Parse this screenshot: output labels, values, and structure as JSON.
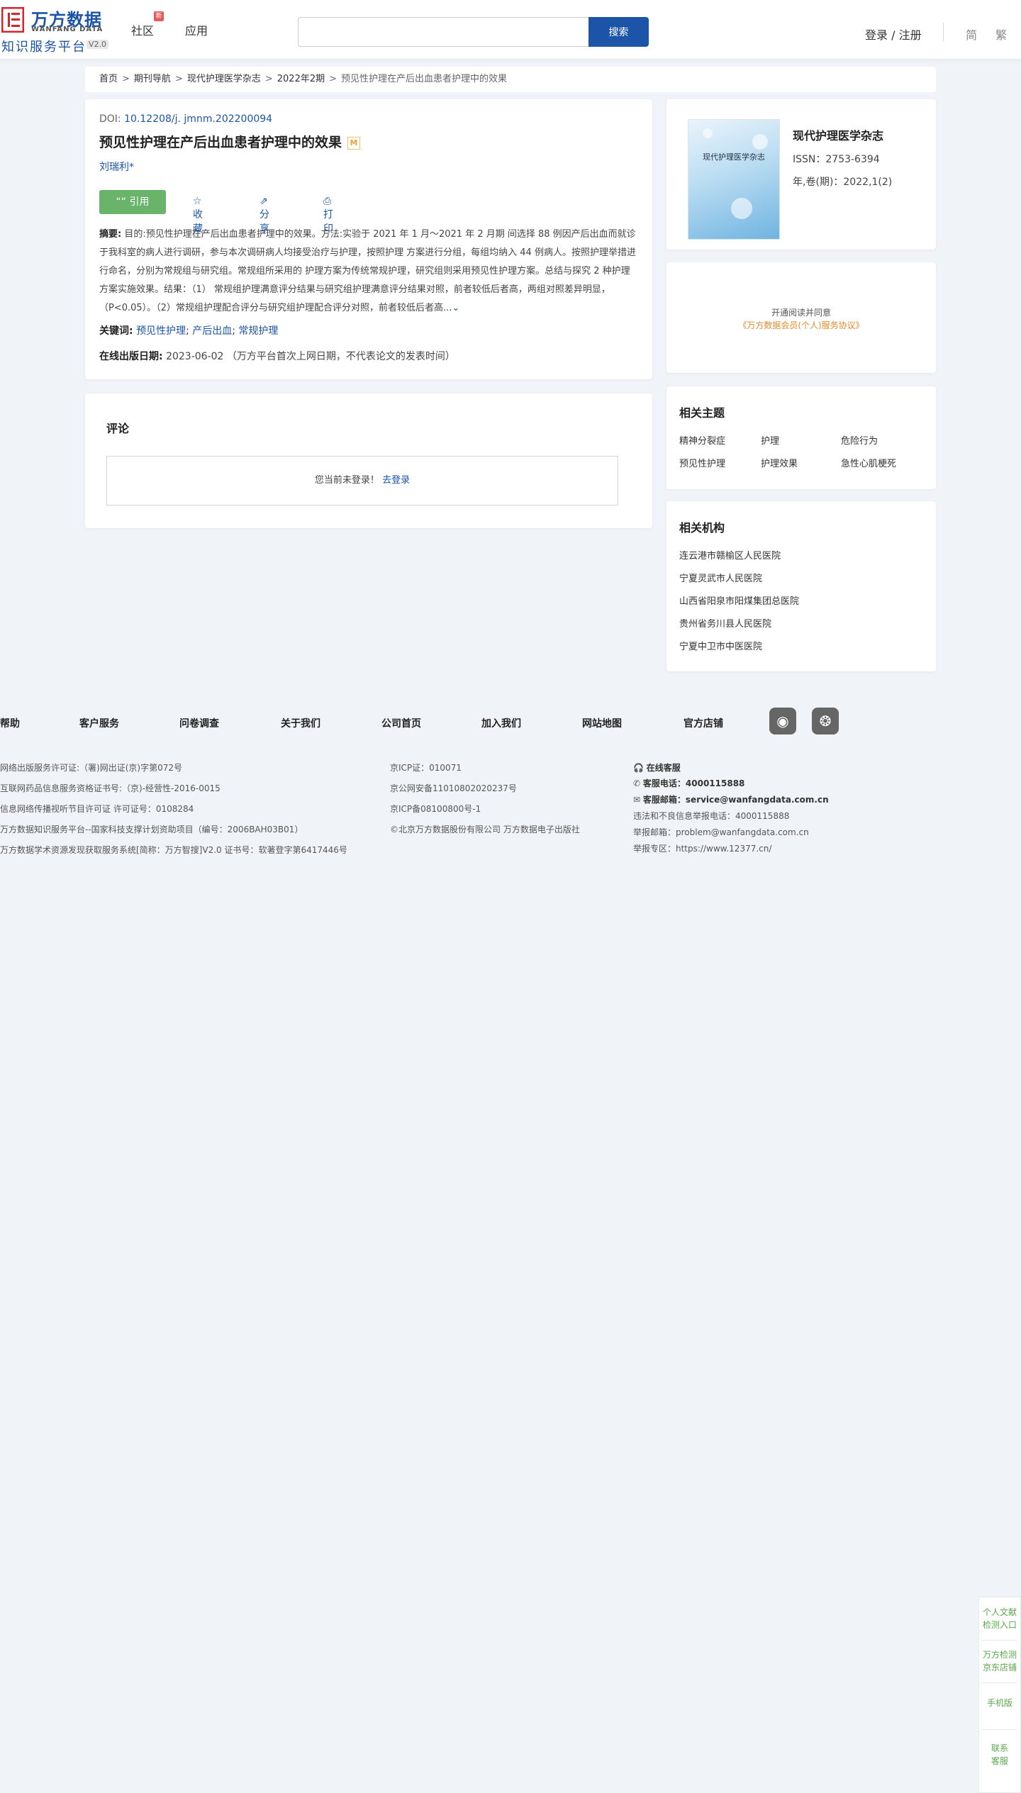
{
  "header": {
    "logo_cn": "万方数据",
    "logo_en": "WANFANG DATA",
    "logo_sub": "知识服务平台",
    "logo_version": "V2.0",
    "nav": [
      "社区",
      "应用"
    ],
    "nav_badge": "新",
    "search_placeholder": "",
    "search_button": "搜索",
    "login": "登录 / 注册",
    "lang_simplified": "简",
    "lang_traditional": "繁"
  },
  "breadcrumb": [
    "首页",
    "期刊导航",
    "现代护理医学杂志",
    "2022年2期",
    "预见性护理在产后出血患者护理中的效果"
  ],
  "article": {
    "doi_label": "DOI:",
    "doi": "10.12208/j. jmnm.202200094",
    "title": "预见性护理在产后出血患者护理中的效果",
    "title_badge": "M",
    "author": "刘瑞利*",
    "actions": {
      "cite": "引用",
      "favorite": "收藏",
      "share": "分享",
      "print": "打印"
    },
    "abstract_label": "摘要:",
    "abstract": "目的:预见性护理在产后出血患者护理中的效果。方法:实验于 2021 年 1 月～2021 年 2 月期 间选择 88 例因产后出血而就诊于我科室的病人进行调研，参与本次调研病人均接受治疗与护理，按照护理 方案进行分组，每组均纳入 44 例病人。按照护理举措进行命名，分别为常规组与研究组。常规组所采用的 护理方案为传统常规护理，研究组则采用预见性护理方案。总结与探究 2 种护理方案实施效果。结果：（1） 常规组护理满意评分结果与研究组护理满意评分结果对照，前者较低后者高，两组对照差异明显，（P<0.05）。（2）常规组护理配合评分与研究组护理配合评分对照，前者较低后者高...",
    "keywords_label": "关键词:",
    "keywords": [
      "预见性护理",
      "产后出血",
      "常规护理"
    ],
    "date_label": "在线出版日期:",
    "date": "2023-06-02",
    "date_note": "（万方平台首次上网日期，不代表论文的发表时间）"
  },
  "comment": {
    "title": "评论",
    "notice": "您当前未登录！",
    "login_link": "去登录"
  },
  "journal": {
    "cover_title": "现代护理医学杂志",
    "name": "现代护理医学杂志",
    "issn": "ISSN：2753-6394",
    "volume": "年,卷(期)：2022,1(2)"
  },
  "subscribe": {
    "line1": "开通阅读并同意",
    "line2": "《万方数据会员(个人)服务协议》"
  },
  "topics": {
    "title": "相关主题",
    "items": [
      "精神分裂症",
      "护理",
      "危险行为",
      "预见性护理",
      "护理效果",
      "急性心肌梗死"
    ]
  },
  "orgs": {
    "title": "相关机构",
    "items": [
      "连云港市赣榆区人民医院",
      "宁夏灵武市人民医院",
      "山西省阳泉市阳煤集团总医院",
      "贵州省务川县人民医院",
      "宁夏中卫市中医医院"
    ]
  },
  "footer": {
    "links": [
      "帮助",
      "客户服务",
      "问卷调查",
      "关于我们",
      "公司首页",
      "加入我们",
      "网站地图",
      "官方店铺"
    ],
    "col1": [
      "网络出版服务许可证:（署)网出证(京)字第072号",
      "互联网药品信息服务资格证书号:（京)-经营性-2016-0015",
      "信息网络传播视听节目许可证 许可证号：0108284",
      "万方数据知识服务平台--国家科技支撑计划资助项目（编号：2006BAH03B01）",
      "万方数据学术资源发现获取服务系统[简称：万方智搜]V2.0 证书号：软著登字第6417446号"
    ],
    "col2": [
      "京ICP证：010071",
      "京公网安备11010802020237号",
      "京ICP备08100800号-1",
      "©北京万方数据股份有限公司 万方数据电子出版社"
    ],
    "col3": {
      "online": "在线客服",
      "phone_label": "客服电话：",
      "phone": "4000115888",
      "email_label": "客服邮箱：",
      "email": "service@wanfangdata.com.cn",
      "report_phone": "违法和不良信息举报电话：4000115888",
      "report_email": "举报邮箱：problem@wanfangdata.com.cn",
      "report_site": "举报专区：https://www.12377.cn/"
    }
  },
  "side": {
    "items": [
      "个人文献\n检测入口",
      "万方检测\n京东店铺",
      "手机版",
      "联系\n客服"
    ]
  }
}
